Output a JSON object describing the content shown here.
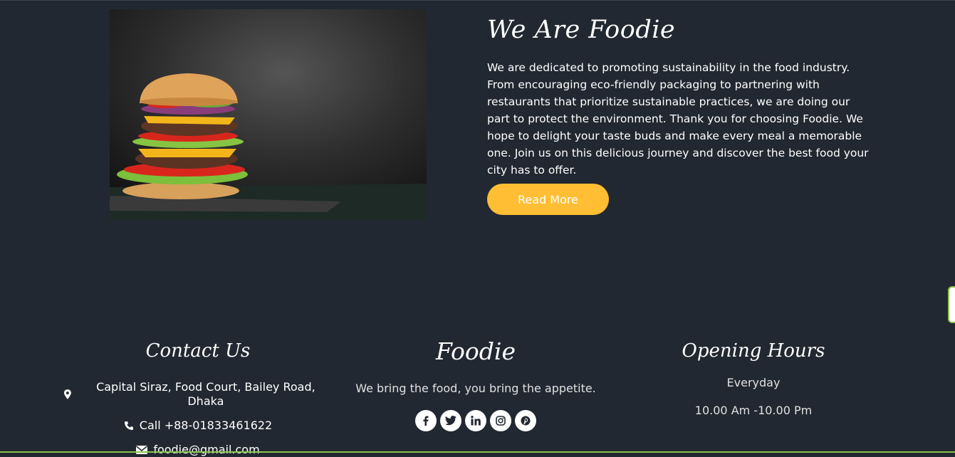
{
  "about": {
    "title": "We Are Foodie",
    "description": "We are dedicated to promoting sustainability in the food industry. From encouraging eco-friendly packaging to partnering with restaurants that prioritize sustainable practices, we are doing our part to protect the environment. Thank you for choosing Foodie. We hope to delight your taste buds and make every meal a memorable one. Join us on this delicious journey and discover the best food your city has to offer.",
    "button_label": "Read More",
    "image": "burger-photo"
  },
  "footer": {
    "contact": {
      "heading": "Contact Us",
      "address": "Capital Siraz, Food Court, Bailey Road, Dhaka",
      "address_icon": "map-marker-icon",
      "phone": "Call +88-01833461622",
      "phone_icon": "phone-icon",
      "email": "foodie@gmail.com",
      "email_icon": "envelope-icon"
    },
    "brand": {
      "heading": "Foodie",
      "tagline": "We bring the food, you bring the appetite.",
      "socials": [
        {
          "name": "facebook-icon",
          "glyph": "f"
        },
        {
          "name": "twitter-icon",
          "glyph": ""
        },
        {
          "name": "linkedin-icon",
          "glyph": "in"
        },
        {
          "name": "instagram-icon",
          "glyph": ""
        },
        {
          "name": "pinterest-icon",
          "glyph": "p"
        }
      ]
    },
    "hours": {
      "heading": "Opening Hours",
      "days": "Everyday",
      "time": "10.00 Am -10.00 Pm"
    }
  },
  "colors": {
    "background": "#222831",
    "accent": "#ffbe33",
    "text": "#ffffff"
  }
}
